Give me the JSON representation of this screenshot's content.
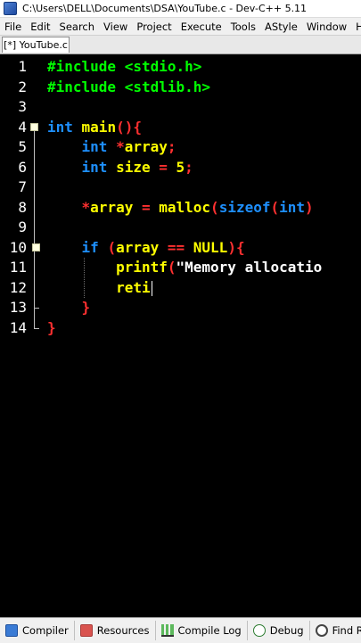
{
  "window": {
    "title": "C:\\Users\\DELL\\Documents\\DSA\\YouTube.c - Dev-C++ 5.11"
  },
  "menu": [
    {
      "key": "File",
      "label": "File"
    },
    {
      "key": "Edit",
      "label": "Edit"
    },
    {
      "key": "Search",
      "label": "Search"
    },
    {
      "key": "View",
      "label": "View"
    },
    {
      "key": "Project",
      "label": "Project"
    },
    {
      "key": "Execute",
      "label": "Execute"
    },
    {
      "key": "Tools",
      "label": "Tools"
    },
    {
      "key": "AStyle",
      "label": "AStyle"
    },
    {
      "key": "Window",
      "label": "Window"
    },
    {
      "key": "Help",
      "label": "Help"
    }
  ],
  "tab": {
    "label": "[*] YouTube.c"
  },
  "editor": {
    "lines": [
      {
        "n": "1",
        "tokens": [
          [
            "pre",
            "#include <stdio.h>"
          ]
        ]
      },
      {
        "n": "2",
        "tokens": [
          [
            "pre",
            "#include <stdlib.h>"
          ]
        ]
      },
      {
        "n": "3",
        "tokens": []
      },
      {
        "n": "4",
        "tokens": [
          [
            "type",
            "int"
          ],
          [
            "plain",
            " main"
          ],
          [
            "op",
            "(){"
          ]
        ]
      },
      {
        "n": "5",
        "tokens": [
          [
            "plain",
            "    "
          ],
          [
            "type",
            "int"
          ],
          [
            "plain",
            " "
          ],
          [
            "op",
            "*"
          ],
          [
            "plain",
            "array"
          ],
          [
            "op",
            ";"
          ]
        ]
      },
      {
        "n": "6",
        "tokens": [
          [
            "plain",
            "    "
          ],
          [
            "type",
            "int"
          ],
          [
            "plain",
            " size "
          ],
          [
            "op",
            "="
          ],
          [
            "plain",
            " "
          ],
          [
            "num",
            "5"
          ],
          [
            "op",
            ";"
          ]
        ]
      },
      {
        "n": "7",
        "tokens": []
      },
      {
        "n": "8",
        "tokens": [
          [
            "plain",
            "    "
          ],
          [
            "op",
            "*"
          ],
          [
            "plain",
            "array "
          ],
          [
            "op",
            "="
          ],
          [
            "plain",
            " malloc"
          ],
          [
            "op",
            "("
          ],
          [
            "kw",
            "sizeof"
          ],
          [
            "op",
            "("
          ],
          [
            "type",
            "int"
          ],
          [
            "op",
            ")"
          ]
        ]
      },
      {
        "n": "9",
        "tokens": []
      },
      {
        "n": "10",
        "tokens": [
          [
            "plain",
            "    "
          ],
          [
            "kw",
            "if"
          ],
          [
            "plain",
            " "
          ],
          [
            "op",
            "("
          ],
          [
            "plain",
            "array "
          ],
          [
            "op",
            "=="
          ],
          [
            "plain",
            " NULL"
          ],
          [
            "op",
            "){"
          ]
        ]
      },
      {
        "n": "11",
        "tokens": [
          [
            "plain",
            "        printf"
          ],
          [
            "op",
            "("
          ],
          [
            "str",
            "\"Memory allocatio"
          ]
        ]
      },
      {
        "n": "12",
        "tokens": [
          [
            "plain",
            "        reti"
          ]
        ]
      },
      {
        "n": "13",
        "tokens": [
          [
            "plain",
            "    "
          ],
          [
            "brace",
            "}"
          ]
        ]
      },
      {
        "n": "14",
        "tokens": [
          [
            "brace",
            "}"
          ]
        ]
      }
    ]
  },
  "panels": [
    {
      "key": "compiler",
      "label": "Compiler",
      "icon": "compiler-icon"
    },
    {
      "key": "resources",
      "label": "Resources",
      "icon": "resources-icon"
    },
    {
      "key": "compile-log",
      "label": "Compile Log",
      "icon": "compile-log-icon"
    },
    {
      "key": "debug",
      "label": "Debug",
      "icon": "debug-icon"
    },
    {
      "key": "find-results",
      "label": "Find Results",
      "icon": "find-results-icon"
    }
  ],
  "colors": {
    "editor_bg": "#000000",
    "preprocessor": "#00ff00",
    "keyword": "#1e90ff",
    "identifier": "#ffff00",
    "operator": "#ff3030",
    "string": "#ffffff"
  }
}
